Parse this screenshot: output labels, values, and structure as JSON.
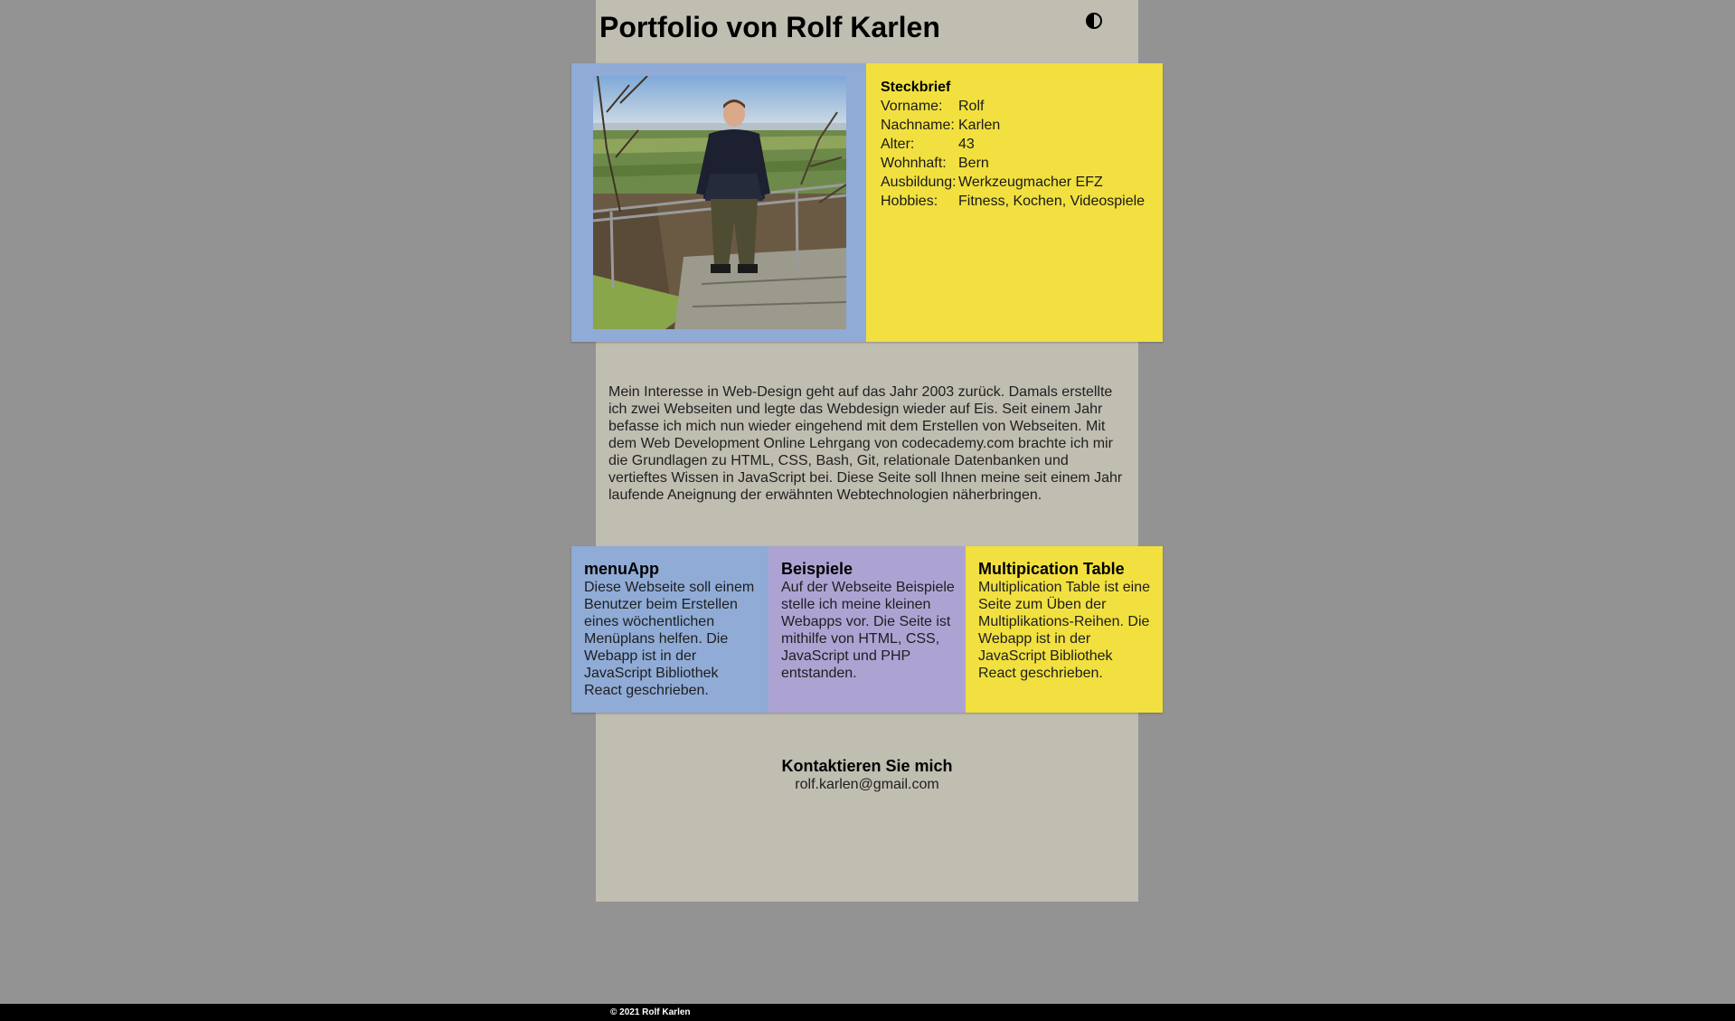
{
  "header": {
    "title": "Portfolio von Rolf Karlen",
    "theme_toggle_icon": "contrast-icon"
  },
  "profile": {
    "photo_alt": "Rolf Karlen",
    "steckbrief": {
      "title": "Steckbrief",
      "rows": [
        {
          "label": "Vorname:",
          "value": "Rolf"
        },
        {
          "label": "Nachname:",
          "value": "Karlen"
        },
        {
          "label": "Alter:",
          "value": "43"
        },
        {
          "label": "Wohnhaft:",
          "value": "Bern"
        },
        {
          "label": "Ausbildung:",
          "value": "Werkzeugmacher EFZ"
        },
        {
          "label": "Hobbies:",
          "value": "Fitness, Kochen, Videospiele"
        }
      ]
    }
  },
  "intro": {
    "text": "Mein Interesse in Web-Design geht auf das Jahr 2003 zurück. Damals erstellte ich zwei Webseiten und legte das Webdesign wieder auf Eis. Seit einem Jahr befasse ich mich nun wieder eingehend mit dem Erstellen von Webseiten. Mit dem Web Development Online Lehrgang von codecademy.com brachte ich mir die Grundlagen zu HTML, CSS, Bash, Git, relationale Datenbanken und vertieftes Wissen in JavaScript bei. Diese Seite soll Ihnen meine seit einem Jahr laufende Aneignung der erwähnten Webtechnologien näherbringen."
  },
  "projects": [
    {
      "title": "menuApp",
      "description": "Diese Webseite soll einem Benutzer beim Erstellen eines wöchentlichen Menüplans helfen. Die Webapp ist in der JavaScript Bibliothek React geschrieben."
    },
    {
      "title": "Beispiele",
      "description": "Auf der Webseite Beispiele stelle ich meine kleinen Webapps vor. Die Seite ist mithilfe von HTML, CSS, JavaScript und PHP entstanden."
    },
    {
      "title": "Multipication Table",
      "description": "Multiplication Table ist eine Seite zum Üben der Multiplikations-Reihen. Die Webapp ist in der JavaScript Bibliothek React geschrieben."
    }
  ],
  "contact": {
    "title": "Kontaktieren Sie mich",
    "email": "rolf.karlen@gmail.com"
  },
  "footer": {
    "copyright": "© 2021 Rolf Karlen"
  },
  "colors": {
    "page_background": "#939393",
    "column_background": "#c0bdb1",
    "blue": "#8fabd6",
    "purple": "#ada3d3",
    "yellow": "#f1e03f",
    "footer": "#000000"
  }
}
